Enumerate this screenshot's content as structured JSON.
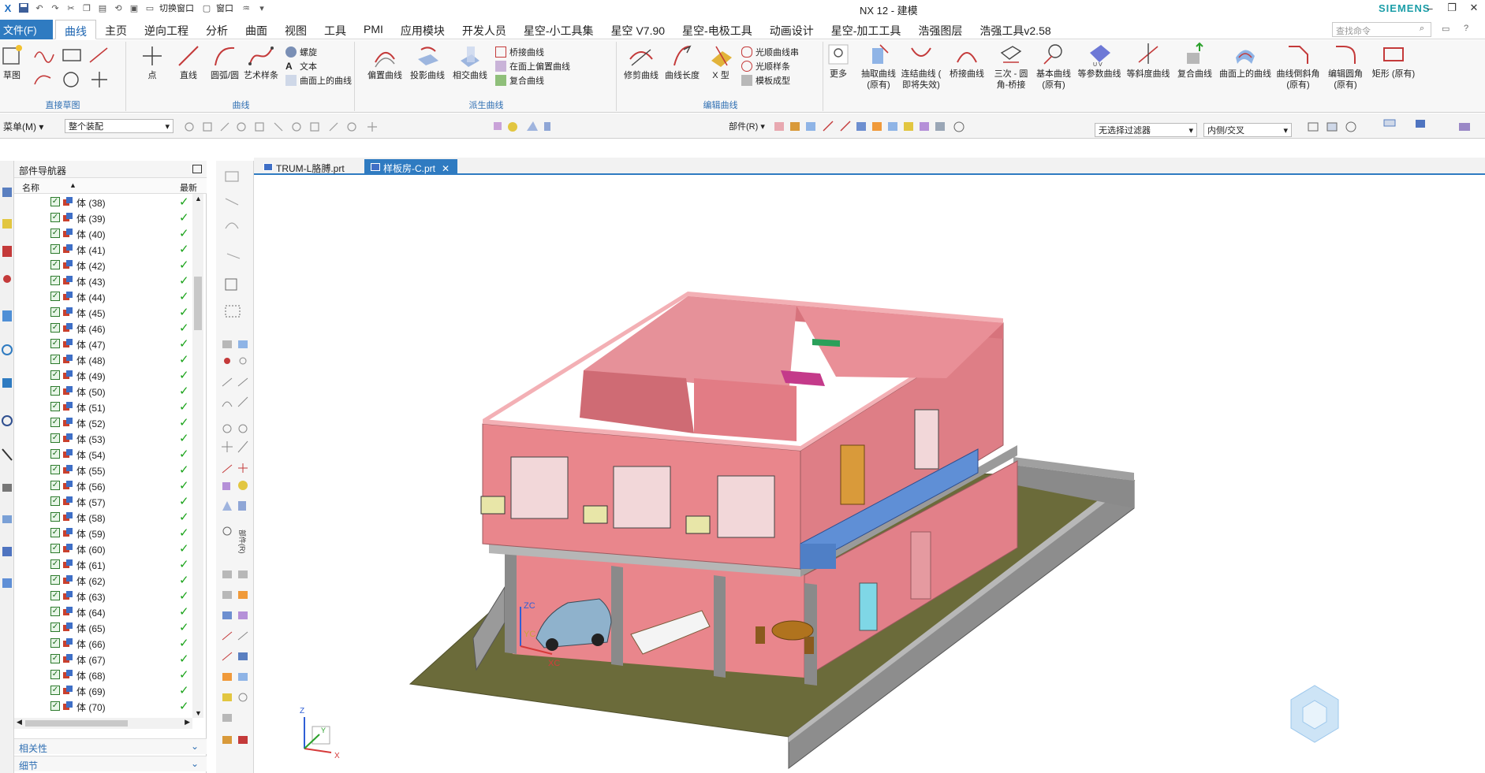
{
  "window": {
    "title": "NX 12 - 建模",
    "brand": "SIEMENS"
  },
  "qat": {
    "switch_window": "切换窗口",
    "window": "窗口"
  },
  "menu": {
    "file": "文件(F)",
    "tabs": [
      "曲线",
      "主页",
      "逆向工程",
      "分析",
      "曲面",
      "视图",
      "工具",
      "PMI",
      "应用模块",
      "开发人员",
      "星空-小工具集",
      "星空 V7.90",
      "星空-电极工具",
      "动画设计",
      "星空-加工工具",
      "浩强图层",
      "浩强工具v2.58"
    ],
    "active_tab": "曲线",
    "search_placeholder": "查找命令"
  },
  "ribbon": {
    "groups": {
      "direct_sketch": "直接草图",
      "curve": "曲线",
      "derived_curve": "派生曲线",
      "edit_curve": "编辑曲线"
    },
    "sketch": "草图",
    "point": "点",
    "line": "直线",
    "arc": "圆弧/圆",
    "art_spline": "艺术样条",
    "helix": "螺旋",
    "text": "文本",
    "curve_on_surface": "曲面上的曲线",
    "offset_curve": "偏置曲线",
    "project_curve": "投影曲线",
    "intersect_curve": "相交曲线",
    "bridge_curve": "桥接曲线",
    "offset_in_face": "在面上偏置曲线",
    "composite_curve": "复合曲线",
    "trim_curve": "修剪曲线",
    "curve_length": "曲线长度",
    "x_form": "X 型",
    "smooth_curve_chain": "光顺曲线串",
    "smooth_spline": "光顺样条",
    "template_form": "模板成型",
    "more": "更多",
    "extract_curve": "抽取曲线",
    "extract_curve_note": "(原有)",
    "continuous_curve": "连结曲线 (",
    "continuous_curve_note": "即将失效)",
    "bridge_curve2": "桥接曲线",
    "three_fillet": "三次 - 圆",
    "three_fillet_note": "角-桥接",
    "basic_curve": "基本曲线",
    "basic_curve_note": "(原有)",
    "iso_curve": "等参数曲线",
    "isocline_curve": "等斜度曲线",
    "composite_curve2": "复合曲线",
    "curve_on_surface2": "曲面上的曲线",
    "curve_chamfer": "曲线倒斜角",
    "curve_chamfer_note": "(原有)",
    "edit_fillet": "编辑圆角",
    "edit_fillet_note": "(原有)",
    "rectangle": "矩形 (原有)"
  },
  "toolbar2": {
    "menu": "菜单(M)",
    "assembly_scope": "整个装配",
    "component": "部件(R)",
    "filter": "无选择过滤器",
    "selection_mode": "内侧/交叉"
  },
  "navigator": {
    "title": "部件导航器",
    "col_name": "名称",
    "col_latest": "最新",
    "rows": [
      "体 (38)",
      "体 (39)",
      "体 (40)",
      "体 (41)",
      "体 (42)",
      "体 (43)",
      "体 (44)",
      "体 (45)",
      "体 (46)",
      "体 (47)",
      "体 (48)",
      "体 (49)",
      "体 (50)",
      "体 (51)",
      "体 (52)",
      "体 (53)",
      "体 (54)",
      "体 (55)",
      "体 (56)",
      "体 (57)",
      "体 (58)",
      "体 (59)",
      "体 (60)",
      "体 (61)",
      "体 (62)",
      "体 (63)",
      "体 (64)",
      "体 (65)",
      "体 (66)",
      "体 (67)",
      "体 (68)",
      "体 (69)",
      "体 (70)"
    ],
    "panel_dependency": "相关性",
    "panel_details": "细节"
  },
  "doc_tabs": [
    "TRUM-L胳膊.prt",
    "样板房-C.prt"
  ],
  "active_doc": "样板房-C.prt",
  "csys": {
    "zc": "ZC",
    "yc": "YC",
    "xc": "XC",
    "x": "X",
    "y": "Y",
    "z": "Z"
  },
  "vtools_label": "部件(R)",
  "colors": {
    "accent": "#2f7bc1",
    "wall": "#e9868c",
    "ground": "#6b6b3a",
    "slab": "#b6b6b6",
    "balcony": "#5f8fd6"
  }
}
